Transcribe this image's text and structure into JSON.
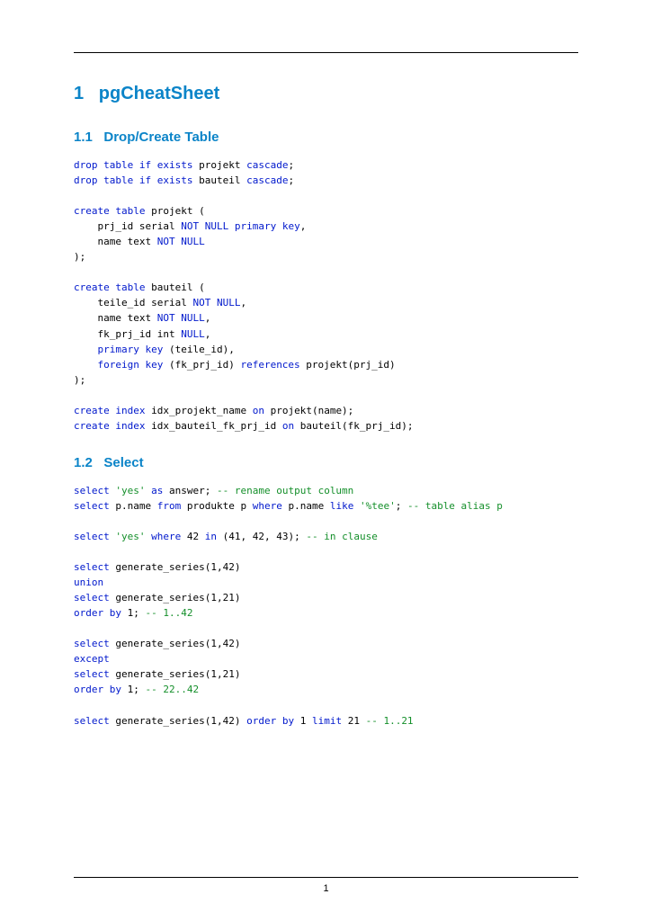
{
  "page_number": "1",
  "section": {
    "number": "1",
    "title": "pgCheatSheet"
  },
  "subsections": [
    {
      "number": "1.1",
      "title": "Drop/Create Table"
    },
    {
      "number": "1.2",
      "title": "Select"
    }
  ],
  "code_block_1": {
    "tokens": [
      [
        "kw",
        "drop"
      ],
      [
        "p",
        " "
      ],
      [
        "kw",
        "table"
      ],
      [
        "p",
        " "
      ],
      [
        "kw",
        "if"
      ],
      [
        "p",
        " "
      ],
      [
        "kw",
        "exists"
      ],
      [
        "p",
        " projekt "
      ],
      [
        "kw",
        "cascade"
      ],
      [
        "p",
        ";\n"
      ],
      [
        "kw",
        "drop"
      ],
      [
        "p",
        " "
      ],
      [
        "kw",
        "table"
      ],
      [
        "p",
        " "
      ],
      [
        "kw",
        "if"
      ],
      [
        "p",
        " "
      ],
      [
        "kw",
        "exists"
      ],
      [
        "p",
        " bauteil "
      ],
      [
        "kw",
        "cascade"
      ],
      [
        "p",
        ";\n"
      ],
      [
        "p",
        "\n"
      ],
      [
        "kw",
        "create"
      ],
      [
        "p",
        " "
      ],
      [
        "kw",
        "table"
      ],
      [
        "p",
        " projekt (\n"
      ],
      [
        "p",
        "    prj_id serial "
      ],
      [
        "kw",
        "NOT"
      ],
      [
        "p",
        " "
      ],
      [
        "kw",
        "NULL"
      ],
      [
        "p",
        " "
      ],
      [
        "kw",
        "primary"
      ],
      [
        "p",
        " "
      ],
      [
        "kw",
        "key"
      ],
      [
        "p",
        ",\n"
      ],
      [
        "p",
        "    name text "
      ],
      [
        "kw",
        "NOT"
      ],
      [
        "p",
        " "
      ],
      [
        "kw",
        "NULL"
      ],
      [
        "p",
        "\n"
      ],
      [
        "p",
        ");\n"
      ],
      [
        "p",
        "\n"
      ],
      [
        "kw",
        "create"
      ],
      [
        "p",
        " "
      ],
      [
        "kw",
        "table"
      ],
      [
        "p",
        " bauteil (\n"
      ],
      [
        "p",
        "    teile_id serial "
      ],
      [
        "kw",
        "NOT"
      ],
      [
        "p",
        " "
      ],
      [
        "kw",
        "NULL"
      ],
      [
        "p",
        ",\n"
      ],
      [
        "p",
        "    name text "
      ],
      [
        "kw",
        "NOT"
      ],
      [
        "p",
        " "
      ],
      [
        "kw",
        "NULL"
      ],
      [
        "p",
        ",\n"
      ],
      [
        "p",
        "    fk_prj_id int "
      ],
      [
        "kw",
        "NULL"
      ],
      [
        "p",
        ",\n"
      ],
      [
        "p",
        "    "
      ],
      [
        "kw",
        "primary"
      ],
      [
        "p",
        " "
      ],
      [
        "kw",
        "key"
      ],
      [
        "p",
        " (teile_id),\n"
      ],
      [
        "p",
        "    "
      ],
      [
        "kw",
        "foreign"
      ],
      [
        "p",
        " "
      ],
      [
        "kw",
        "key"
      ],
      [
        "p",
        " (fk_prj_id) "
      ],
      [
        "kw",
        "references"
      ],
      [
        "p",
        " projekt(prj_id)\n"
      ],
      [
        "p",
        ");\n"
      ],
      [
        "p",
        "\n"
      ],
      [
        "kw",
        "create"
      ],
      [
        "p",
        " "
      ],
      [
        "kw",
        "index"
      ],
      [
        "p",
        " idx_projekt_name "
      ],
      [
        "kw",
        "on"
      ],
      [
        "p",
        " projekt(name);\n"
      ],
      [
        "kw",
        "create"
      ],
      [
        "p",
        " "
      ],
      [
        "kw",
        "index"
      ],
      [
        "p",
        " idx_bauteil_fk_prj_id "
      ],
      [
        "kw",
        "on"
      ],
      [
        "p",
        " bauteil(fk_prj_id);\n"
      ]
    ]
  },
  "code_block_2": {
    "tokens": [
      [
        "kw",
        "select"
      ],
      [
        "p",
        " "
      ],
      [
        "str",
        "'yes'"
      ],
      [
        "p",
        " "
      ],
      [
        "kw",
        "as"
      ],
      [
        "p",
        " answer; "
      ],
      [
        "com",
        "-- rename output column"
      ],
      [
        "p",
        "\n"
      ],
      [
        "kw",
        "select"
      ],
      [
        "p",
        " p.name "
      ],
      [
        "kw",
        "from"
      ],
      [
        "p",
        " produkte p "
      ],
      [
        "kw",
        "where"
      ],
      [
        "p",
        " p.name "
      ],
      [
        "kw",
        "like"
      ],
      [
        "p",
        " "
      ],
      [
        "str",
        "'%tee'"
      ],
      [
        "p",
        "; "
      ],
      [
        "com",
        "-- table alias p"
      ],
      [
        "p",
        "\n"
      ],
      [
        "p",
        "\n"
      ],
      [
        "kw",
        "select"
      ],
      [
        "p",
        " "
      ],
      [
        "str",
        "'yes'"
      ],
      [
        "p",
        " "
      ],
      [
        "kw",
        "where"
      ],
      [
        "p",
        " 42 "
      ],
      [
        "kw",
        "in"
      ],
      [
        "p",
        " (41, 42, 43); "
      ],
      [
        "com",
        "-- in clause"
      ],
      [
        "p",
        "\n"
      ],
      [
        "p",
        "\n"
      ],
      [
        "kw",
        "select"
      ],
      [
        "p",
        " generate_series(1,42)\n"
      ],
      [
        "kw",
        "union"
      ],
      [
        "p",
        "\n"
      ],
      [
        "kw",
        "select"
      ],
      [
        "p",
        " generate_series(1,21)\n"
      ],
      [
        "kw",
        "order"
      ],
      [
        "p",
        " "
      ],
      [
        "kw",
        "by"
      ],
      [
        "p",
        " 1; "
      ],
      [
        "com",
        "-- 1..42"
      ],
      [
        "p",
        "\n"
      ],
      [
        "p",
        "\n"
      ],
      [
        "kw",
        "select"
      ],
      [
        "p",
        " generate_series(1,42)\n"
      ],
      [
        "kw",
        "except"
      ],
      [
        "p",
        "\n"
      ],
      [
        "kw",
        "select"
      ],
      [
        "p",
        " generate_series(1,21)\n"
      ],
      [
        "kw",
        "order"
      ],
      [
        "p",
        " "
      ],
      [
        "kw",
        "by"
      ],
      [
        "p",
        " 1; "
      ],
      [
        "com",
        "-- 22..42"
      ],
      [
        "p",
        "\n"
      ],
      [
        "p",
        "\n"
      ],
      [
        "kw",
        "select"
      ],
      [
        "p",
        " generate_series(1,42) "
      ],
      [
        "kw",
        "order"
      ],
      [
        "p",
        " "
      ],
      [
        "kw",
        "by"
      ],
      [
        "p",
        " 1 "
      ],
      [
        "kw",
        "limit"
      ],
      [
        "p",
        " 21 "
      ],
      [
        "com",
        "-- 1..21"
      ],
      [
        "p",
        "\n"
      ]
    ]
  }
}
